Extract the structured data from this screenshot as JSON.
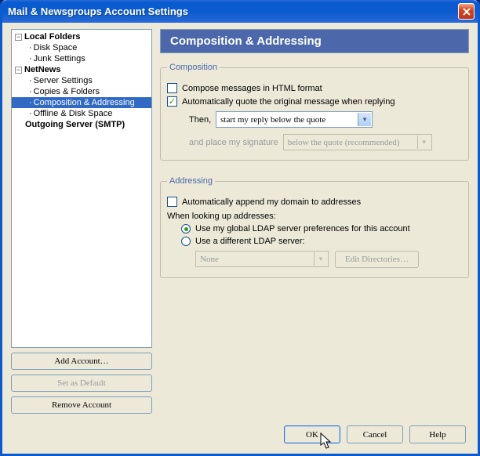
{
  "window": {
    "title": "Mail & Newsgroups Account Settings"
  },
  "tree": {
    "root1": {
      "label": "Local Folders"
    },
    "root1_children": [
      {
        "label": "Disk Space"
      },
      {
        "label": "Junk Settings"
      }
    ],
    "root2": {
      "label": "NetNews"
    },
    "root2_children": [
      {
        "label": "Server Settings"
      },
      {
        "label": "Copies & Folders"
      },
      {
        "label": "Composition & Addressing"
      },
      {
        "label": "Offline & Disk Space"
      }
    ],
    "root3": {
      "label": "Outgoing Server (SMTP)"
    }
  },
  "sidebar_buttons": {
    "add": "Add Account…",
    "default": "Set as Default",
    "remove": "Remove Account"
  },
  "main": {
    "header": "Composition & Addressing",
    "composition": {
      "legend": "Composition",
      "html_label": "Compose messages in HTML format",
      "autoquote_label": "Automatically quote the original message when replying",
      "then_label": "Then,",
      "reply_select": "start my reply below the quote",
      "sig_label": "and place my signature",
      "sig_select": "below the quote (recommended)"
    },
    "addressing": {
      "legend": "Addressing",
      "append_label": "Automatically append my domain to addresses",
      "lookup_label": "When looking up addresses:",
      "opt_global": "Use my global LDAP server preferences for this account",
      "opt_diff": "Use a different LDAP server:",
      "ldap_select": "None",
      "edit_btn": "Edit Directories…"
    }
  },
  "footer": {
    "ok": "OK",
    "cancel": "Cancel",
    "help": "Help"
  }
}
